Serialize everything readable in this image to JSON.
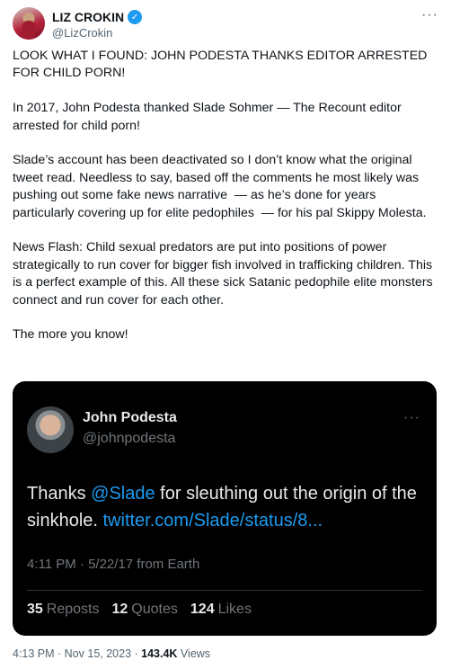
{
  "author": {
    "name": "LIZ CROKIN",
    "handle": "@LizCrokin",
    "verified_icon": "check-icon",
    "more": "···"
  },
  "tweet": {
    "paragraphs": [
      "LOOK WHAT I FOUND: JOHN PODESTA THANKS EDITOR ARRESTED FOR CHILD PORN!",
      "In 2017, John Podesta thanked Slade Sohmer — The Recount editor arrested for child porn!",
      "Slade’s account has been deactivated so I don’t know what the original tweet read. Needless to say, based off the comments he most likely was pushing out some fake news narrative  — as he’s done for years particularly covering up for elite pedophiles  — for his pal Skippy Molesta.",
      "News Flash: Child sexual predators are put into positions of power strategically to run cover for bigger fish involved in trafficking children. This is a perfect example of this. All these sick Satanic pedophile elite monsters connect and run cover for each other.",
      "The more you know!"
    ]
  },
  "quoted": {
    "name": "John Podesta",
    "handle": "@johnpodesta",
    "more": "···",
    "text_before": "Thanks ",
    "mention": "@Slade",
    "text_after": " for sleuthing out the origin of the sinkhole. ",
    "link": "twitter.com/Slade/status/8...",
    "timestamp": "4:11 PM · 5/22/17 from Earth",
    "stats": {
      "reposts_count": "35",
      "reposts_label": "Reposts",
      "quotes_count": "12",
      "quotes_label": "Quotes",
      "likes_count": "124",
      "likes_label": "Likes"
    }
  },
  "meta": {
    "time": "4:13 PM · Nov 15, 2023 · ",
    "views_count": "143.4K",
    "views_label": " Views"
  },
  "colors": {
    "accent": "#1d9bf0",
    "text": "#0f1419",
    "muted": "#536471",
    "quote_bg": "#000000"
  }
}
